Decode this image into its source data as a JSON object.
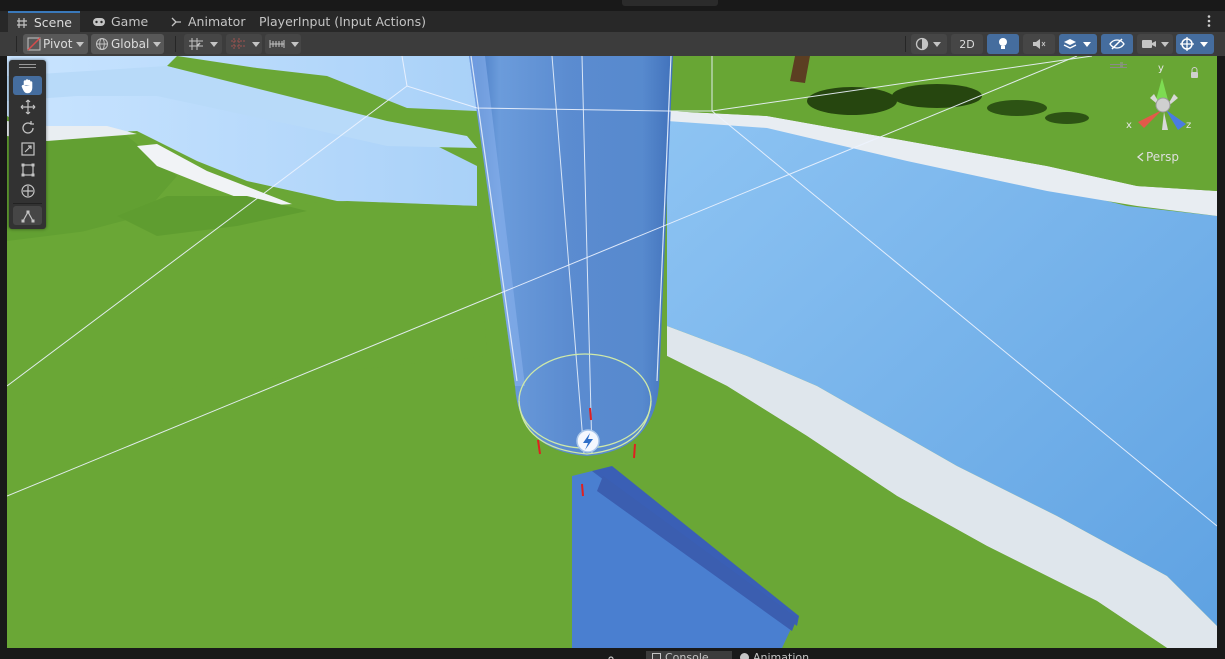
{
  "tabs": [
    {
      "label": "Scene",
      "icon": "hash-icon",
      "active": true
    },
    {
      "label": "Game",
      "icon": "gamepad-icon",
      "active": false
    },
    {
      "label": "Animator",
      "icon": "animator-icon",
      "active": false
    },
    {
      "label": "PlayerInput (Input Actions)",
      "icon": "",
      "active": false
    }
  ],
  "toolbar": {
    "pivot_label": "Pivot",
    "global_label": "Global",
    "mode_2d_label": "2D"
  },
  "viewport": {
    "projection_label": "Persp",
    "gizmo_axes": {
      "x": "x",
      "y": "y",
      "z": "z"
    }
  },
  "bottom_tabs": {
    "console_label": "Console",
    "animation_label": "Animation"
  },
  "colors": {
    "accent": "#3a79bb",
    "grass": "#6aa736",
    "water": "#73b1ea",
    "capsule": "#4f82d3"
  }
}
